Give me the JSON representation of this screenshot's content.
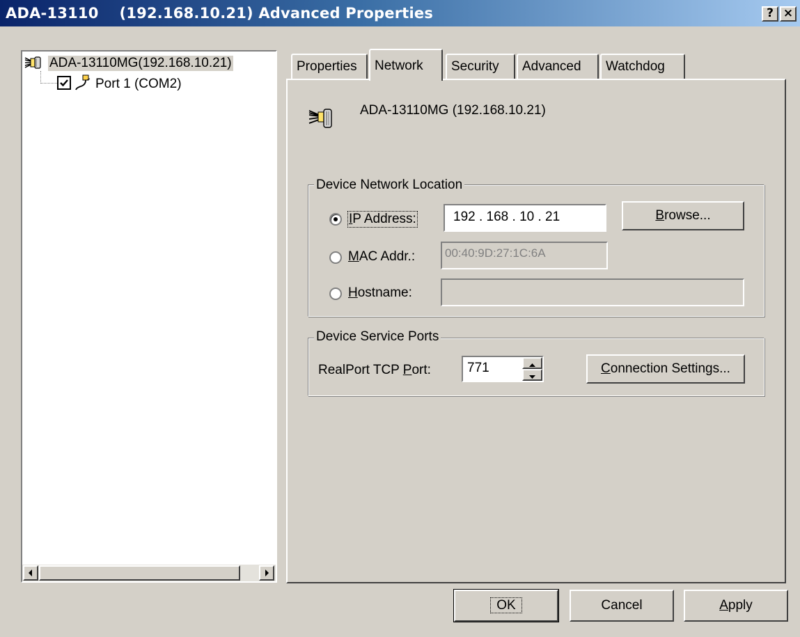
{
  "window": {
    "title": "ADA-13110    (192.168.10.21) Advanced Properties",
    "help_btn": "?",
    "close_btn": "×"
  },
  "tree": {
    "root_label": "ADA-13110MG(192.168.10.21)",
    "child_label": "Port 1 (COM2)",
    "child_checked": true
  },
  "tabs": [
    "Properties",
    "Network",
    "Security",
    "Advanced",
    "Watchdog"
  ],
  "active_tab": "Network",
  "network": {
    "device_label": "ADA-13110MG (192.168.10.21)",
    "location": {
      "title": "Device Network Location",
      "ip_label_key": "I",
      "ip_label_rest": "P Address:",
      "ip_value": "192 . 168 .  10  .  21",
      "browse_key": "B",
      "browse_rest": "rowse...",
      "mac_label_key": "M",
      "mac_label_rest": "AC Addr.:",
      "mac_value": "00:40:9D:27:1C:6A",
      "hostname_label_key": "H",
      "hostname_label_rest": "ostname:",
      "hostname_value": "",
      "selected": "ip"
    },
    "service": {
      "title": "Device Service Ports",
      "realport_label_pre": "RealPort TCP ",
      "realport_label_key": "P",
      "realport_label_post": "ort:",
      "realport_value": "771",
      "conn_key": "C",
      "conn_rest": "onnection Settings..."
    }
  },
  "footer": {
    "ok": "OK",
    "cancel": "Cancel",
    "apply_key": "A",
    "apply_rest": "pply"
  },
  "colors": {
    "face": "#d4d0c8",
    "title_start": "#0a246a",
    "title_end": "#a6caf0"
  }
}
